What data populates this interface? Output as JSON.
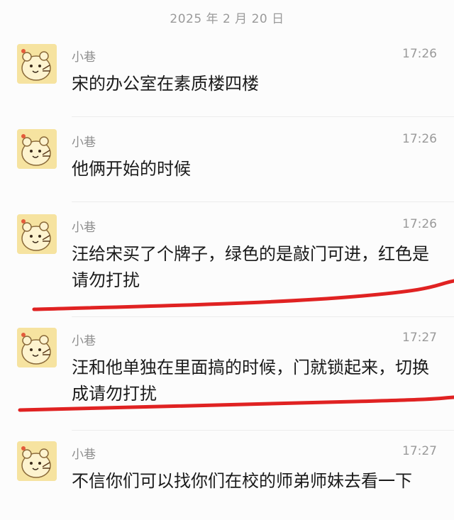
{
  "date_divider": "2025 年 2 月 20 日",
  "colors": {
    "annotation_underline": "#e02222",
    "text": "#1a1a1a",
    "meta": "#9a9a9a"
  },
  "messages": [
    {
      "sender": "小巷",
      "time": "17:26",
      "text": "宋的办公室在素质楼四楼",
      "avatar_icon": "cartoon-bear-avatar-icon"
    },
    {
      "sender": "小巷",
      "time": "17:26",
      "text": "他俩开始的时候",
      "avatar_icon": "cartoon-bear-avatar-icon"
    },
    {
      "sender": "小巷",
      "time": "17:26",
      "text": "汪给宋买了个牌子，绿色的是敲门可进，红色是请勿打扰",
      "avatar_icon": "cartoon-bear-avatar-icon",
      "underlined": true
    },
    {
      "sender": "小巷",
      "time": "17:27",
      "text": "汪和他单独在里面搞的时候，门就锁起来，切换成请勿打扰",
      "avatar_icon": "cartoon-bear-avatar-icon",
      "underlined": true
    },
    {
      "sender": "小巷",
      "time": "17:27",
      "text": "不信你们可以找你们在校的师弟师妹去看一下",
      "avatar_icon": "cartoon-bear-avatar-icon"
    }
  ]
}
